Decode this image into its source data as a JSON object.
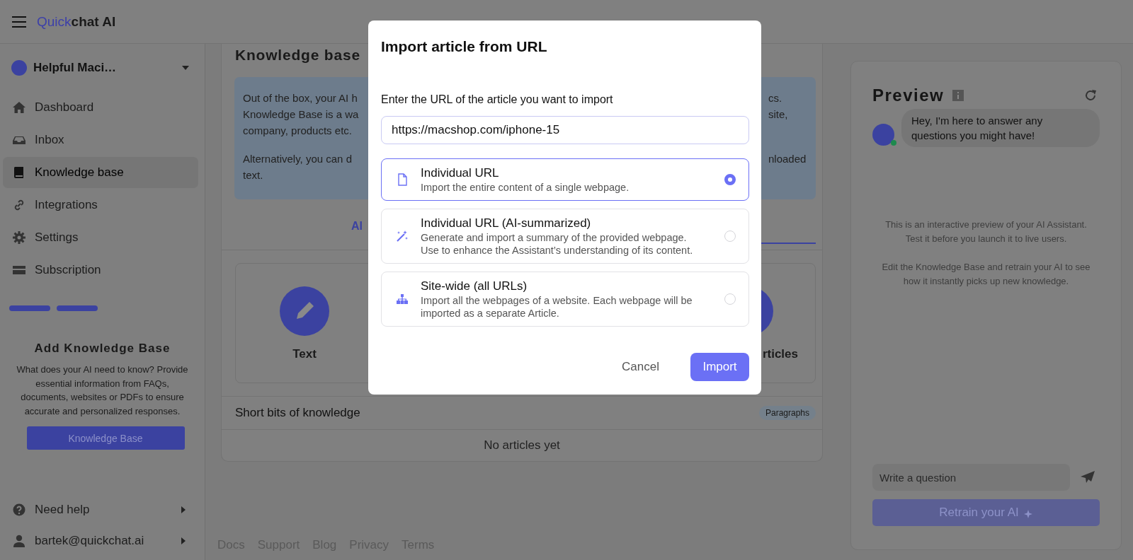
{
  "app": {
    "logo_primary": "Quick",
    "logo_secondary": "chat AI"
  },
  "workspace": {
    "name": "Helpful Maci…"
  },
  "sidebar": {
    "items": [
      {
        "label": "Dashboard",
        "selected": false
      },
      {
        "label": "Inbox",
        "selected": false
      },
      {
        "label": "Knowledge base",
        "selected": true
      },
      {
        "label": "Integrations",
        "selected": false
      },
      {
        "label": "Settings",
        "selected": false
      },
      {
        "label": "Subscription",
        "selected": false
      }
    ],
    "steps": [
      {
        "done": true
      },
      {
        "done": true
      }
    ],
    "promo": {
      "title": "Add Knowledge Base",
      "text": "What does your AI need to know? Provide essential information from FAQs, documents, websites or PDFs to ensure accurate and personalized responses.",
      "button": "Knowledge Base"
    },
    "bottom_items": [
      {
        "label": "Need help"
      },
      {
        "label": "bartek@quickchat.ai"
      }
    ]
  },
  "page": {
    "title": "Knowledge base",
    "info": [
      {
        "lines": [
          {
            "left": "Out of the box, your AI h",
            "right": "cs."
          },
          {
            "left": "Knowledge Base is a wa",
            "right": "site,"
          },
          {
            "left": "company, products etc."
          }
        ]
      },
      {
        "lines": [
          {
            "left": "Alternatively, you can d",
            "right": "nloaded"
          },
          {
            "left": "text."
          }
        ]
      }
    ],
    "tab_fragment": "AI",
    "cards": [
      {
        "label": "Text"
      },
      {
        "label": "rticles"
      }
    ],
    "section": {
      "title": "Short bits of knowledge",
      "badge": "Paragraphs",
      "empty": "No articles yet"
    },
    "footer_links": [
      "Docs",
      "Support",
      "Blog",
      "Privacy",
      "Terms"
    ]
  },
  "preview": {
    "title": "Preview",
    "message": "Hey, I'm here to answer any questions you might have!",
    "avatar_online": true,
    "hints": [
      "This is an interactive preview of your AI Assistant. Test it before you launch it to live users.",
      "Edit the Knowledge Base and retrain your AI to see how it instantly picks up new knowledge."
    ],
    "input": {
      "placeholder": "Write a question"
    },
    "retrain_button": "Retrain your AI"
  },
  "modal": {
    "title": "Import article from URL",
    "label": "Enter the URL of the article you want to import",
    "url": "https://macshop.com/iphone-15",
    "options": [
      {
        "title": "Individual URL",
        "description": "Import the entire content of a single webpage.",
        "selected": true
      },
      {
        "title": "Individual URL (AI-summarized)",
        "description": "Generate and import a summary of the provided webpage. Use to enhance the Assistant’s understanding of its content.",
        "selected": false
      },
      {
        "title": "Site-wide (all URLs)",
        "description": "Import all the webpages of a website. Each webpage will be imported as a separate Article.",
        "selected": false
      }
    ],
    "cancel": "Cancel",
    "confirm": "Import"
  }
}
